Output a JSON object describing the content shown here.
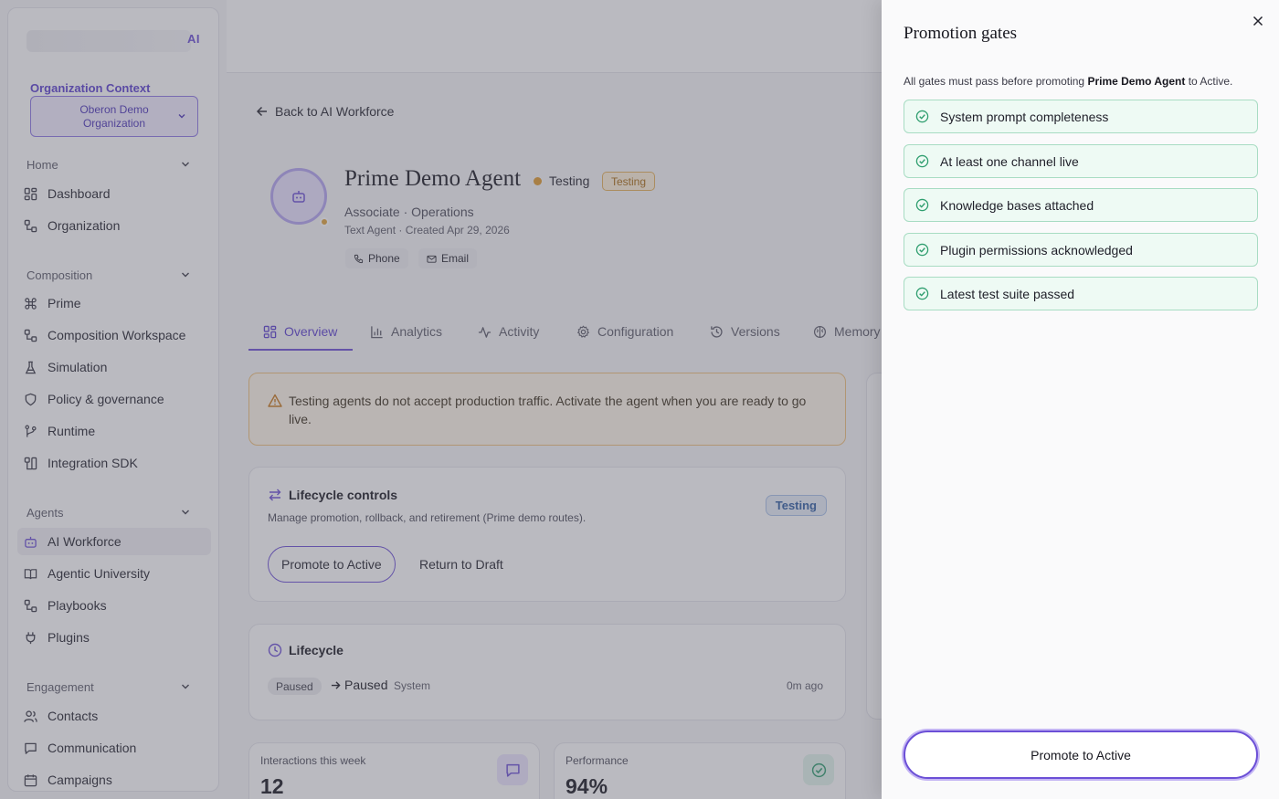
{
  "sidebar": {
    "logo_suffix": "AI",
    "org_context_label": "Organization Context",
    "org_select_value": "Oberon Demo Organization",
    "sections": [
      {
        "label": "Home",
        "items": [
          {
            "label": "Dashboard",
            "icon": "grid-icon"
          },
          {
            "label": "Organization",
            "icon": "org-icon"
          }
        ]
      },
      {
        "label": "Composition",
        "items": [
          {
            "label": "Prime",
            "icon": "command-icon"
          },
          {
            "label": "Composition Workspace",
            "icon": "workflow-icon"
          },
          {
            "label": "Simulation",
            "icon": "flask-icon"
          },
          {
            "label": "Policy & governance",
            "icon": "shield-icon"
          },
          {
            "label": "Runtime",
            "icon": "branch-icon"
          },
          {
            "label": "Integration SDK",
            "icon": "sdk-icon"
          }
        ]
      },
      {
        "label": "Agents",
        "items": [
          {
            "label": "AI Workforce",
            "icon": "bot-icon"
          },
          {
            "label": "Agentic University",
            "icon": "book-icon"
          },
          {
            "label": "Playbooks",
            "icon": "playbook-icon"
          },
          {
            "label": "Plugins",
            "icon": "plug-icon"
          }
        ]
      },
      {
        "label": "Engagement",
        "items": [
          {
            "label": "Contacts",
            "icon": "users-icon"
          },
          {
            "label": "Communication",
            "icon": "message-icon"
          },
          {
            "label": "Campaigns",
            "icon": "calendar-icon"
          }
        ]
      }
    ]
  },
  "main": {
    "back_label": "Back to AI Workforce",
    "agent": {
      "name": "Prime Demo Agent",
      "status": "Testing",
      "badge": "Testing",
      "role": "Associate · Operations",
      "meta": "Text Agent · Created Apr 29, 2026",
      "channels": [
        "Phone",
        "Email"
      ]
    },
    "tabs": [
      "Overview",
      "Analytics",
      "Activity",
      "Configuration",
      "Versions",
      "Memory"
    ],
    "warning": "Testing agents do not accept production traffic. Activate the agent when you are ready to go live.",
    "lifecycle_controls": {
      "title": "Lifecycle controls",
      "description": "Manage promotion, rollback, and retirement (Prime demo routes).",
      "badge": "Testing",
      "promote_label": "Promote to Active",
      "return_label": "Return to Draft"
    },
    "lifecycle": {
      "title": "Lifecycle",
      "from_state": "Paused",
      "to_state": "Paused",
      "actor": "System",
      "time": "0m ago"
    },
    "stats": [
      {
        "label": "Interactions this week",
        "value": "12",
        "icon": "message-icon"
      },
      {
        "label": "Performance",
        "value": "94%",
        "icon": "check-circle-icon"
      }
    ]
  },
  "drawer": {
    "title": "Promotion gates",
    "desc_prefix": "All gates must pass before promoting ",
    "desc_agent": "Prime Demo Agent",
    "desc_suffix": " to Active.",
    "gates": [
      "System prompt completeness",
      "At least one channel live",
      "Knowledge bases attached",
      "Plugin permissions acknowledged",
      "Latest test suite passed"
    ],
    "promote_label": "Promote to Active"
  },
  "colors": {
    "accent": "#6b4fd6",
    "warning": "#e09a2b",
    "success": "#2f9e6f"
  }
}
